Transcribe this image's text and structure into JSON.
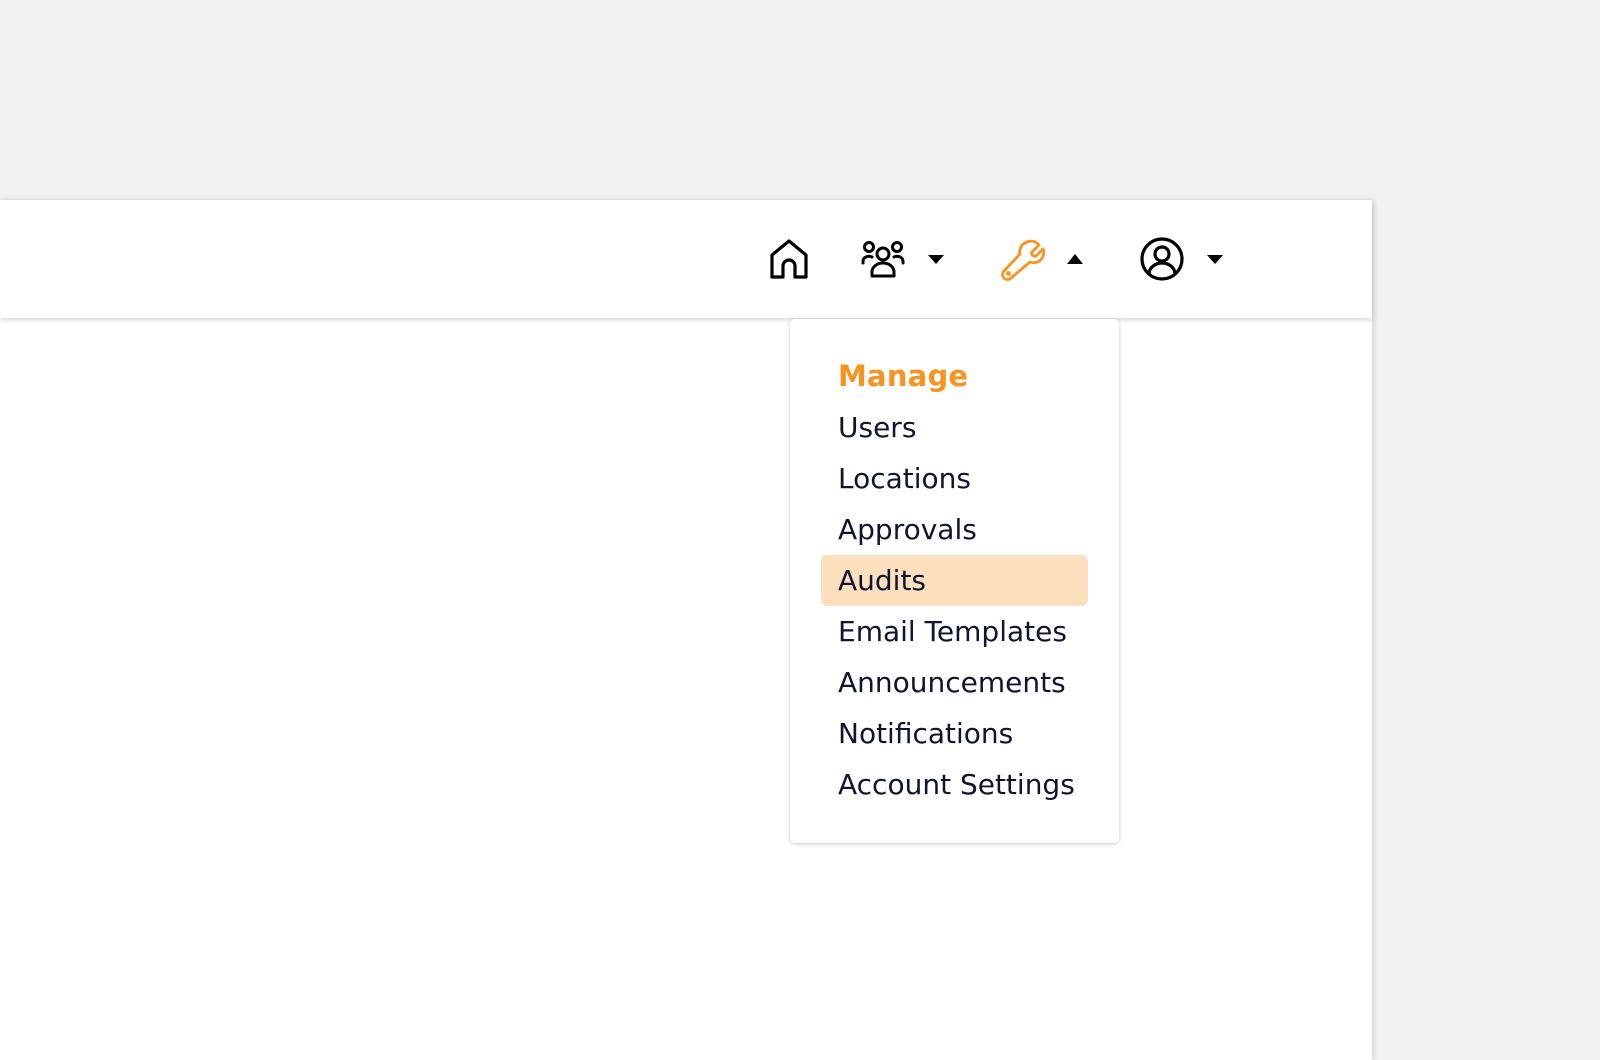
{
  "colors": {
    "accent": "#f7931e",
    "highlight": "#fce0bd",
    "text": "#0f1430",
    "background": "#f2f2f2"
  },
  "nav": {
    "items": [
      {
        "icon": "home-icon"
      },
      {
        "icon": "users-group-icon",
        "caret": "down"
      },
      {
        "icon": "wrench-icon",
        "caret": "up",
        "active": true
      },
      {
        "icon": "user-circle-icon",
        "caret": "down"
      }
    ]
  },
  "manage_menu": {
    "heading": "Manage",
    "items": [
      {
        "label": "Users"
      },
      {
        "label": "Locations"
      },
      {
        "label": "Approvals"
      },
      {
        "label": "Audits",
        "highlighted": true
      },
      {
        "label": "Email Templates"
      },
      {
        "label": "Announcements"
      },
      {
        "label": "Notifications"
      },
      {
        "label": "Account Settings"
      }
    ]
  }
}
